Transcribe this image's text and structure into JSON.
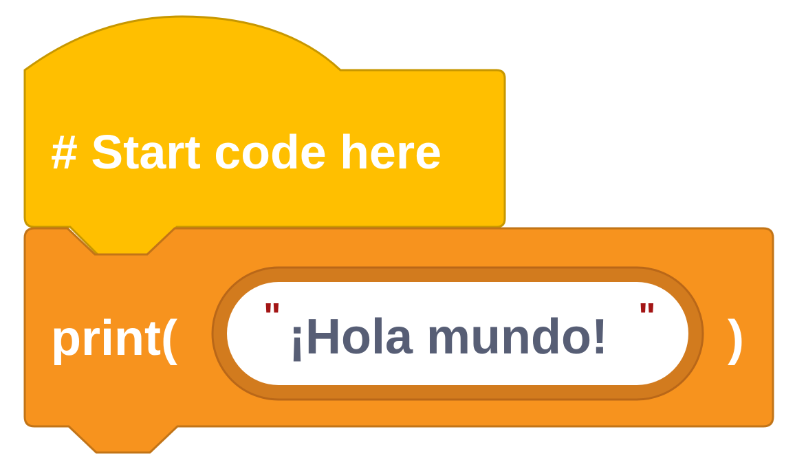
{
  "hat_block": {
    "label": "# Start code here"
  },
  "print_block": {
    "label_open": "print(",
    "label_close": ")",
    "argument": {
      "open_quote": "\"",
      "value": "¡Hola mundo!",
      "close_quote": "\""
    }
  },
  "colors": {
    "hat_fill": "#ffbf00",
    "hat_stroke": "#c79700",
    "print_fill": "#f7931e",
    "print_stroke": "#c27417",
    "input_outer": "#d27b1e",
    "input_fill": "#ffffff",
    "string_text": "#575e75",
    "quote_color": "#a31515"
  }
}
